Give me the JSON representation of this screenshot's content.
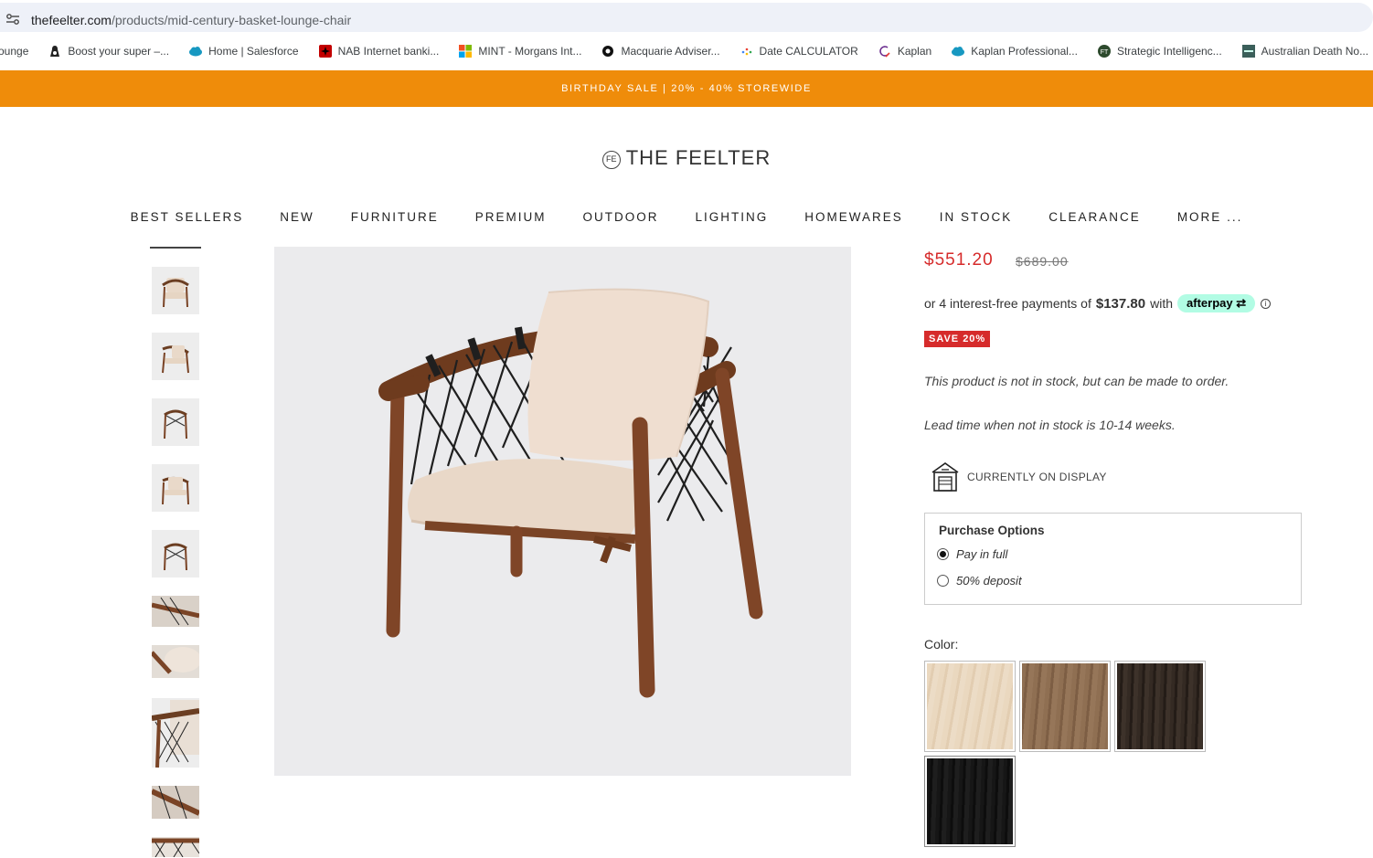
{
  "browser": {
    "url_host": "thefeelter.com",
    "url_path": "/products/mid-century-basket-lounge-chair"
  },
  "bookmarks": [
    {
      "label": "ounge",
      "icon": "none"
    },
    {
      "label": "Boost your super –...",
      "icon": "bag-icon"
    },
    {
      "label": "Home | Salesforce",
      "icon": "salesforce-cloud-icon"
    },
    {
      "label": "NAB Internet banki...",
      "icon": "nab-star-icon"
    },
    {
      "label": "MINT - Morgans Int...",
      "icon": "microsoft-grid-icon"
    },
    {
      "label": "Macquarie Adviser...",
      "icon": "macquarie-circle-icon"
    },
    {
      "label": "Date CALCULATOR",
      "icon": "dots-icon"
    },
    {
      "label": "Kaplan",
      "icon": "kaplan-icon"
    },
    {
      "label": "Kaplan Professional...",
      "icon": "salesforce-cloud-icon"
    },
    {
      "label": "Strategic Intelligenc...",
      "icon": "ft-icon"
    },
    {
      "label": "Australian Death No...",
      "icon": "adn-icon"
    }
  ],
  "promo": {
    "text": "BIRTHDAY SALE | 20% - 40% STOREWIDE"
  },
  "logo": {
    "text": "THE FEELTER",
    "mark": "FE"
  },
  "nav": [
    "BEST SELLERS",
    "NEW",
    "FURNITURE",
    "PREMIUM",
    "OUTDOOR",
    "LIGHTING",
    "HOMEWARES",
    "IN STOCK",
    "CLEARANCE",
    "MORE ..."
  ],
  "product": {
    "price": "$551.20",
    "compare_price": "$689.00",
    "afterpay_prefix": "or 4 interest-free payments of",
    "afterpay_amount": "$137.80",
    "afterpay_suffix": "with",
    "afterpay_brand": "afterpay",
    "save_badge": "SAVE 20%",
    "stock_note": "This product is not in stock, but can be made to order.",
    "lead_note": "Lead time when not in stock is 10-14 weeks.",
    "display_label": "CURRENTLY ON DISPLAY",
    "purchase_title": "Purchase Options",
    "purchase_options": [
      {
        "label": "Pay in full",
        "selected": true
      },
      {
        "label": "50% deposit",
        "selected": false
      }
    ],
    "color_label": "Color:",
    "colors": [
      "#e6d2b8",
      "#8a6a4e",
      "#2f2620",
      "#141414"
    ]
  },
  "colors": {
    "promo": "#ef8c0a",
    "sale_red": "#d62b2b",
    "afterpay_mint": "#b2fce4"
  }
}
